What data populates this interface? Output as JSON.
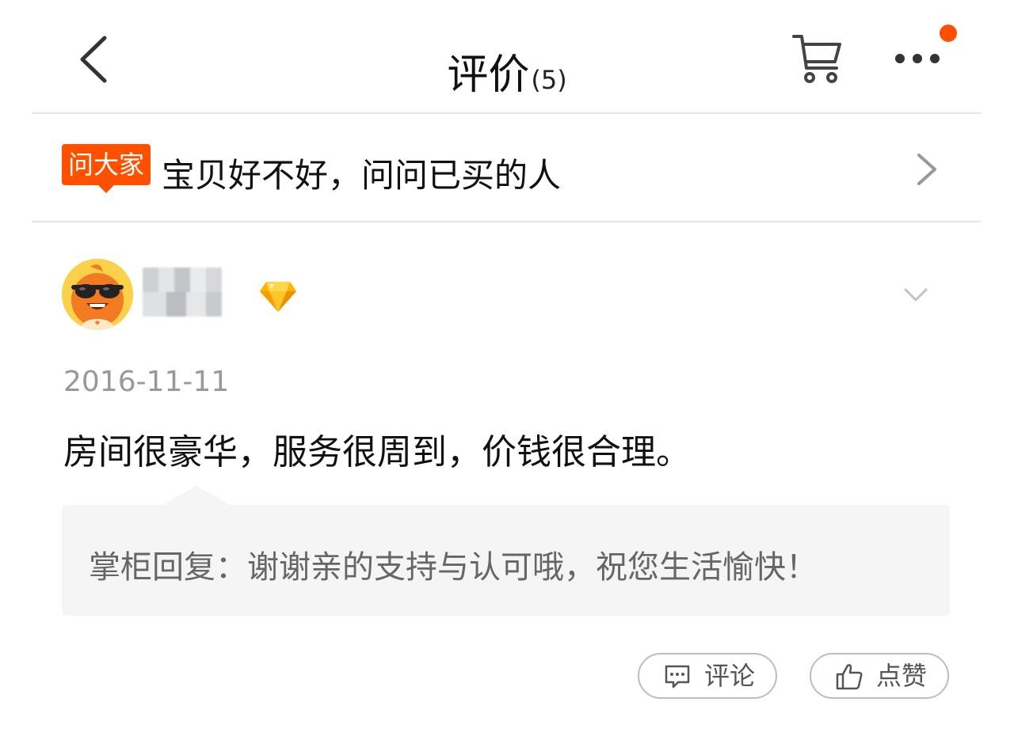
{
  "header": {
    "title": "评价",
    "count": "(5)",
    "back_icon": "chevron-left-icon",
    "cart_icon": "cart-icon",
    "more_icon": "more-horizontal-icon",
    "notification_color": "#ff5000"
  },
  "ask": {
    "badge": "问大家",
    "prompt": "宝贝好不好，问问已买的人",
    "arrow_icon": "chevron-right-icon",
    "badge_color": "#ff5000"
  },
  "review": {
    "date": "2016-11-11",
    "text": "房间很豪华，服务很周到，价钱很合理。",
    "reply": "掌柜回复：谢谢亲的支持与认可哦，祝您生活愉快！",
    "level_icon": "diamond-icon",
    "expand_icon": "chevron-down-icon"
  },
  "actions": {
    "comment_label": "评论",
    "like_label": "点赞"
  }
}
